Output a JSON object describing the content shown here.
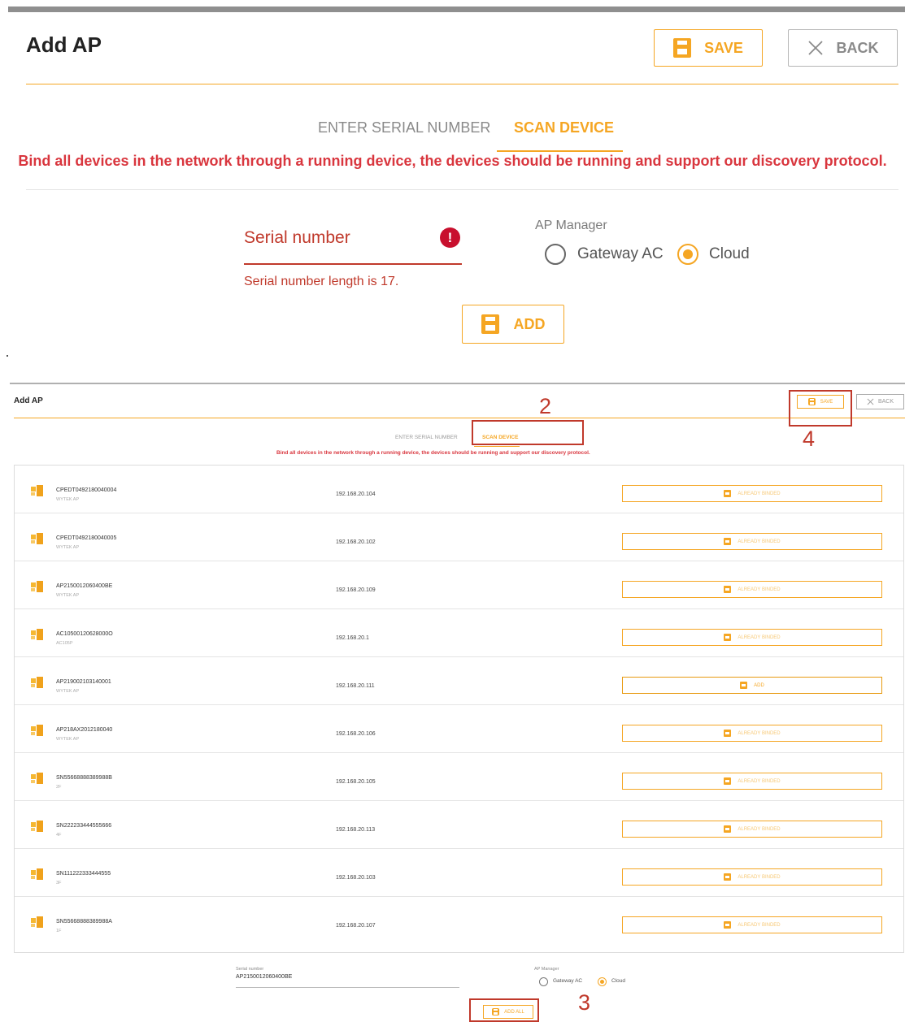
{
  "panel1": {
    "title": "Add AP",
    "save_label": "SAVE",
    "back_label": "BACK",
    "tabs": [
      {
        "label": "ENTER SERIAL NUMBER",
        "active": false
      },
      {
        "label": "SCAN DEVICE",
        "active": true
      }
    ],
    "description": "Bind all devices in the network through a running device, the devices should be running and support our discovery protocol.",
    "serial_label": "Serial number",
    "serial_error": "Serial number length is 17.",
    "ap_manager_label": "AP Manager",
    "ap_manager_options": [
      {
        "label": "Gateway AC",
        "selected": false
      },
      {
        "label": "Cloud",
        "selected": true
      }
    ],
    "add_label": "ADD"
  },
  "panel2": {
    "title": "Add AP",
    "save_label": "SAVE",
    "back_label": "BACK",
    "tabs": [
      {
        "label": "ENTER SERIAL NUMBER",
        "active": false
      },
      {
        "label": "SCAN DEVICE",
        "active": true
      }
    ],
    "description": "Bind all devices in the network through a running device, the devices should be running and support our discovery protocol.",
    "devices": [
      {
        "sn": "CPEDT0492180040004",
        "model": "WYTEK AP",
        "ip": "192.168.20.104",
        "status": "ALREADY BINDED"
      },
      {
        "sn": "CPEDT0492180040005",
        "model": "WYTEK AP",
        "ip": "192.168.20.102",
        "status": "ALREADY BINDED"
      },
      {
        "sn": "AP2150012060400BE",
        "model": "WYTEK AP",
        "ip": "192.168.20.109",
        "status": "ALREADY BINDED"
      },
      {
        "sn": "AC10500120628000O",
        "model": "AC105P",
        "ip": "192.168.20.1",
        "status": "ALREADY BINDED"
      },
      {
        "sn": "AP219002103140001",
        "model": "WYTEK AP",
        "ip": "192.168.20.111",
        "status": "ADD"
      },
      {
        "sn": "AP218AX2012180040",
        "model": "WYTEK AP",
        "ip": "192.168.20.106",
        "status": "ALREADY BINDED"
      },
      {
        "sn": "SN55668888389988B",
        "model": "2F",
        "ip": "192.168.20.105",
        "status": "ALREADY BINDED"
      },
      {
        "sn": "SN222233444555666",
        "model": "4F",
        "ip": "192.168.20.113",
        "status": "ALREADY BINDED"
      },
      {
        "sn": "SN111222333444555",
        "model": "3F",
        "ip": "192.168.20.103",
        "status": "ALREADY BINDED"
      },
      {
        "sn": "SN55668888389988A",
        "model": "1F",
        "ip": "192.168.20.107",
        "status": "ALREADY BINDED"
      }
    ],
    "serial_label": "Serial number",
    "serial_value": "AP2150012060400BE",
    "ap_manager_label": "AP Manager",
    "ap_manager_options": [
      {
        "label": "Gateway AC",
        "selected": false
      },
      {
        "label": "Cloud",
        "selected": true
      }
    ],
    "add_all_label": "ADD ALL"
  },
  "annotations": {
    "step2": "2",
    "step3": "3",
    "step4": "4",
    "color": "#c0392b"
  },
  "colors": {
    "accent": "#f5a623",
    "error": "#d9363e",
    "alert_icon": "#c8102e"
  },
  "icons": {
    "save": "floppy-disk-icon",
    "back": "close-x-icon",
    "alert": "exclamation-circle-icon",
    "device": "network-device-icon"
  }
}
